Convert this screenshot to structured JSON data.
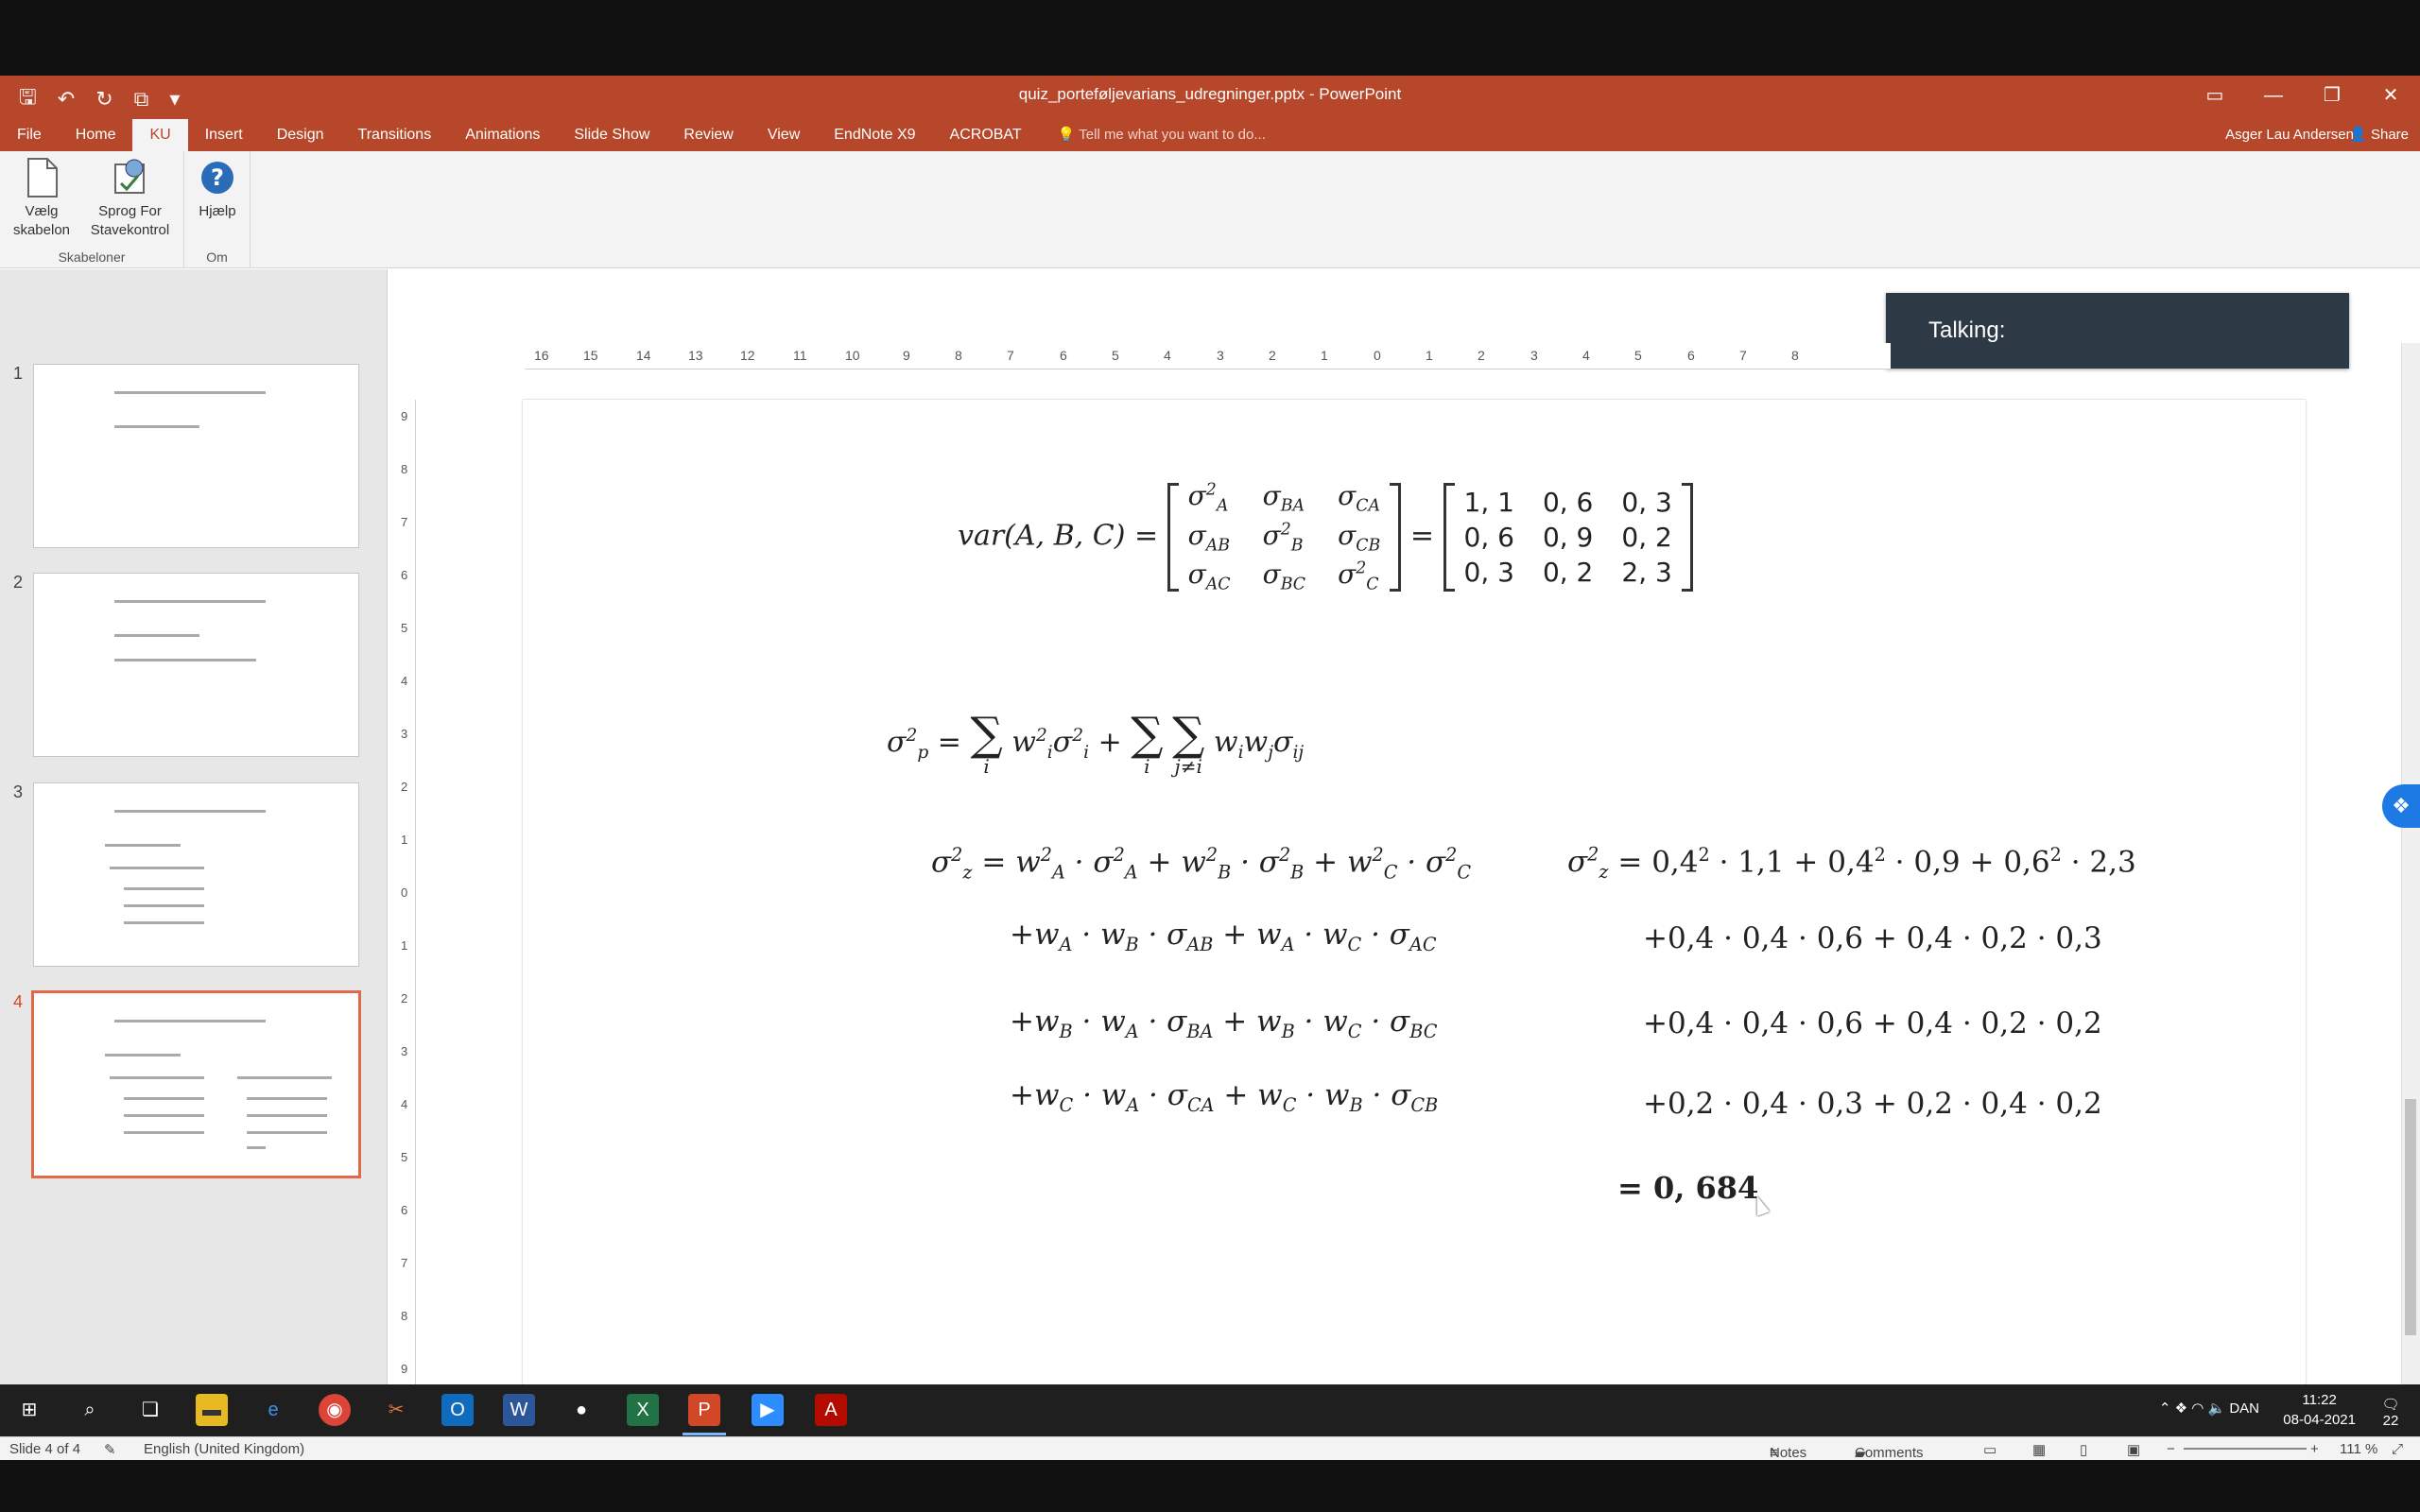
{
  "window": {
    "doc_title": "quiz_porteføljevarians_udregninger.pptx - PowerPoint",
    "user": "Asger Lau Andersen",
    "share": "Share"
  },
  "tabs": [
    "File",
    "Home",
    "KU",
    "Insert",
    "Design",
    "Transitions",
    "Animations",
    "Slide Show",
    "Review",
    "View",
    "EndNote X9",
    "ACROBAT"
  ],
  "active_tab": "KU",
  "tell_me": "Tell me what you want to do...",
  "ribbon": {
    "group1": {
      "btn1": "Vælg",
      "btn1b": "skabelon",
      "btn2": "Sprog For",
      "btn2b": "Stavekontrol",
      "label": "Skabeloner"
    },
    "group2": {
      "btn1": "Hjælp",
      "label": "Om"
    }
  },
  "talking": "Talking:",
  "thumbnails": [
    "1",
    "2",
    "3",
    "4"
  ],
  "ruler_h": [
    "16",
    "15",
    "14",
    "13",
    "12",
    "11",
    "10",
    "9",
    "8",
    "7",
    "6",
    "5",
    "4",
    "3",
    "2",
    "1",
    "0",
    "1",
    "2",
    "3",
    "4",
    "5",
    "6",
    "7",
    "8"
  ],
  "ruler_v": [
    "9",
    "8",
    "7",
    "6",
    "5",
    "4",
    "3",
    "2",
    "1",
    "0",
    "1",
    "2",
    "3",
    "4",
    "5",
    "6",
    "7",
    "8",
    "9"
  ],
  "slide": {
    "var_lhs": "var(A, B, C)",
    "eq": "=",
    "cov_matrix": [
      [
        "σ²_A",
        "σ_BA",
        "σ_CA"
      ],
      [
        "σ_AB",
        "σ²_B",
        "σ_CB"
      ],
      [
        "σ_AC",
        "σ_BC",
        "σ²_C"
      ]
    ],
    "num_matrix": [
      [
        "1, 1",
        "0, 6",
        "0, 3"
      ],
      [
        "0, 6",
        "0, 9",
        "0, 2"
      ],
      [
        "0, 3",
        "0, 2",
        "2, 3"
      ]
    ],
    "formula_sum": {
      "lhs": "σ",
      "sub_p": "p",
      "idx_i": "i",
      "idx_j": "j≠i"
    },
    "left_lines": [
      "σz² = wA² · σA² + wB² · σB² + wC² · σC²",
      "+wA · wB · σAB + wA · wC · σAC",
      "+wB · wA · σBA + wB · wC · σBC",
      "+wC · wA · σCA + wC · wB · σCB"
    ],
    "right_lines": [
      "+0,4 · 0,4 · 0,6 + 0,4 · 0,2 · 0,3",
      "+0,4 · 0,4 · 0,6 + 0,4 · 0,2 · 0,2",
      "+0,2 · 0,4 · 0,3 + 0,2 · 0,4 · 0,2"
    ],
    "result": "= 0, 684"
  },
  "status": {
    "slide": "Slide 4 of 4",
    "language": "English (United Kingdom)",
    "notes": "Notes",
    "comments": "Comments",
    "zoom": "111 %"
  },
  "taskbar": {
    "time": "11:22",
    "date": "08-04-2021",
    "lang": "DAN",
    "notifications": "22"
  }
}
